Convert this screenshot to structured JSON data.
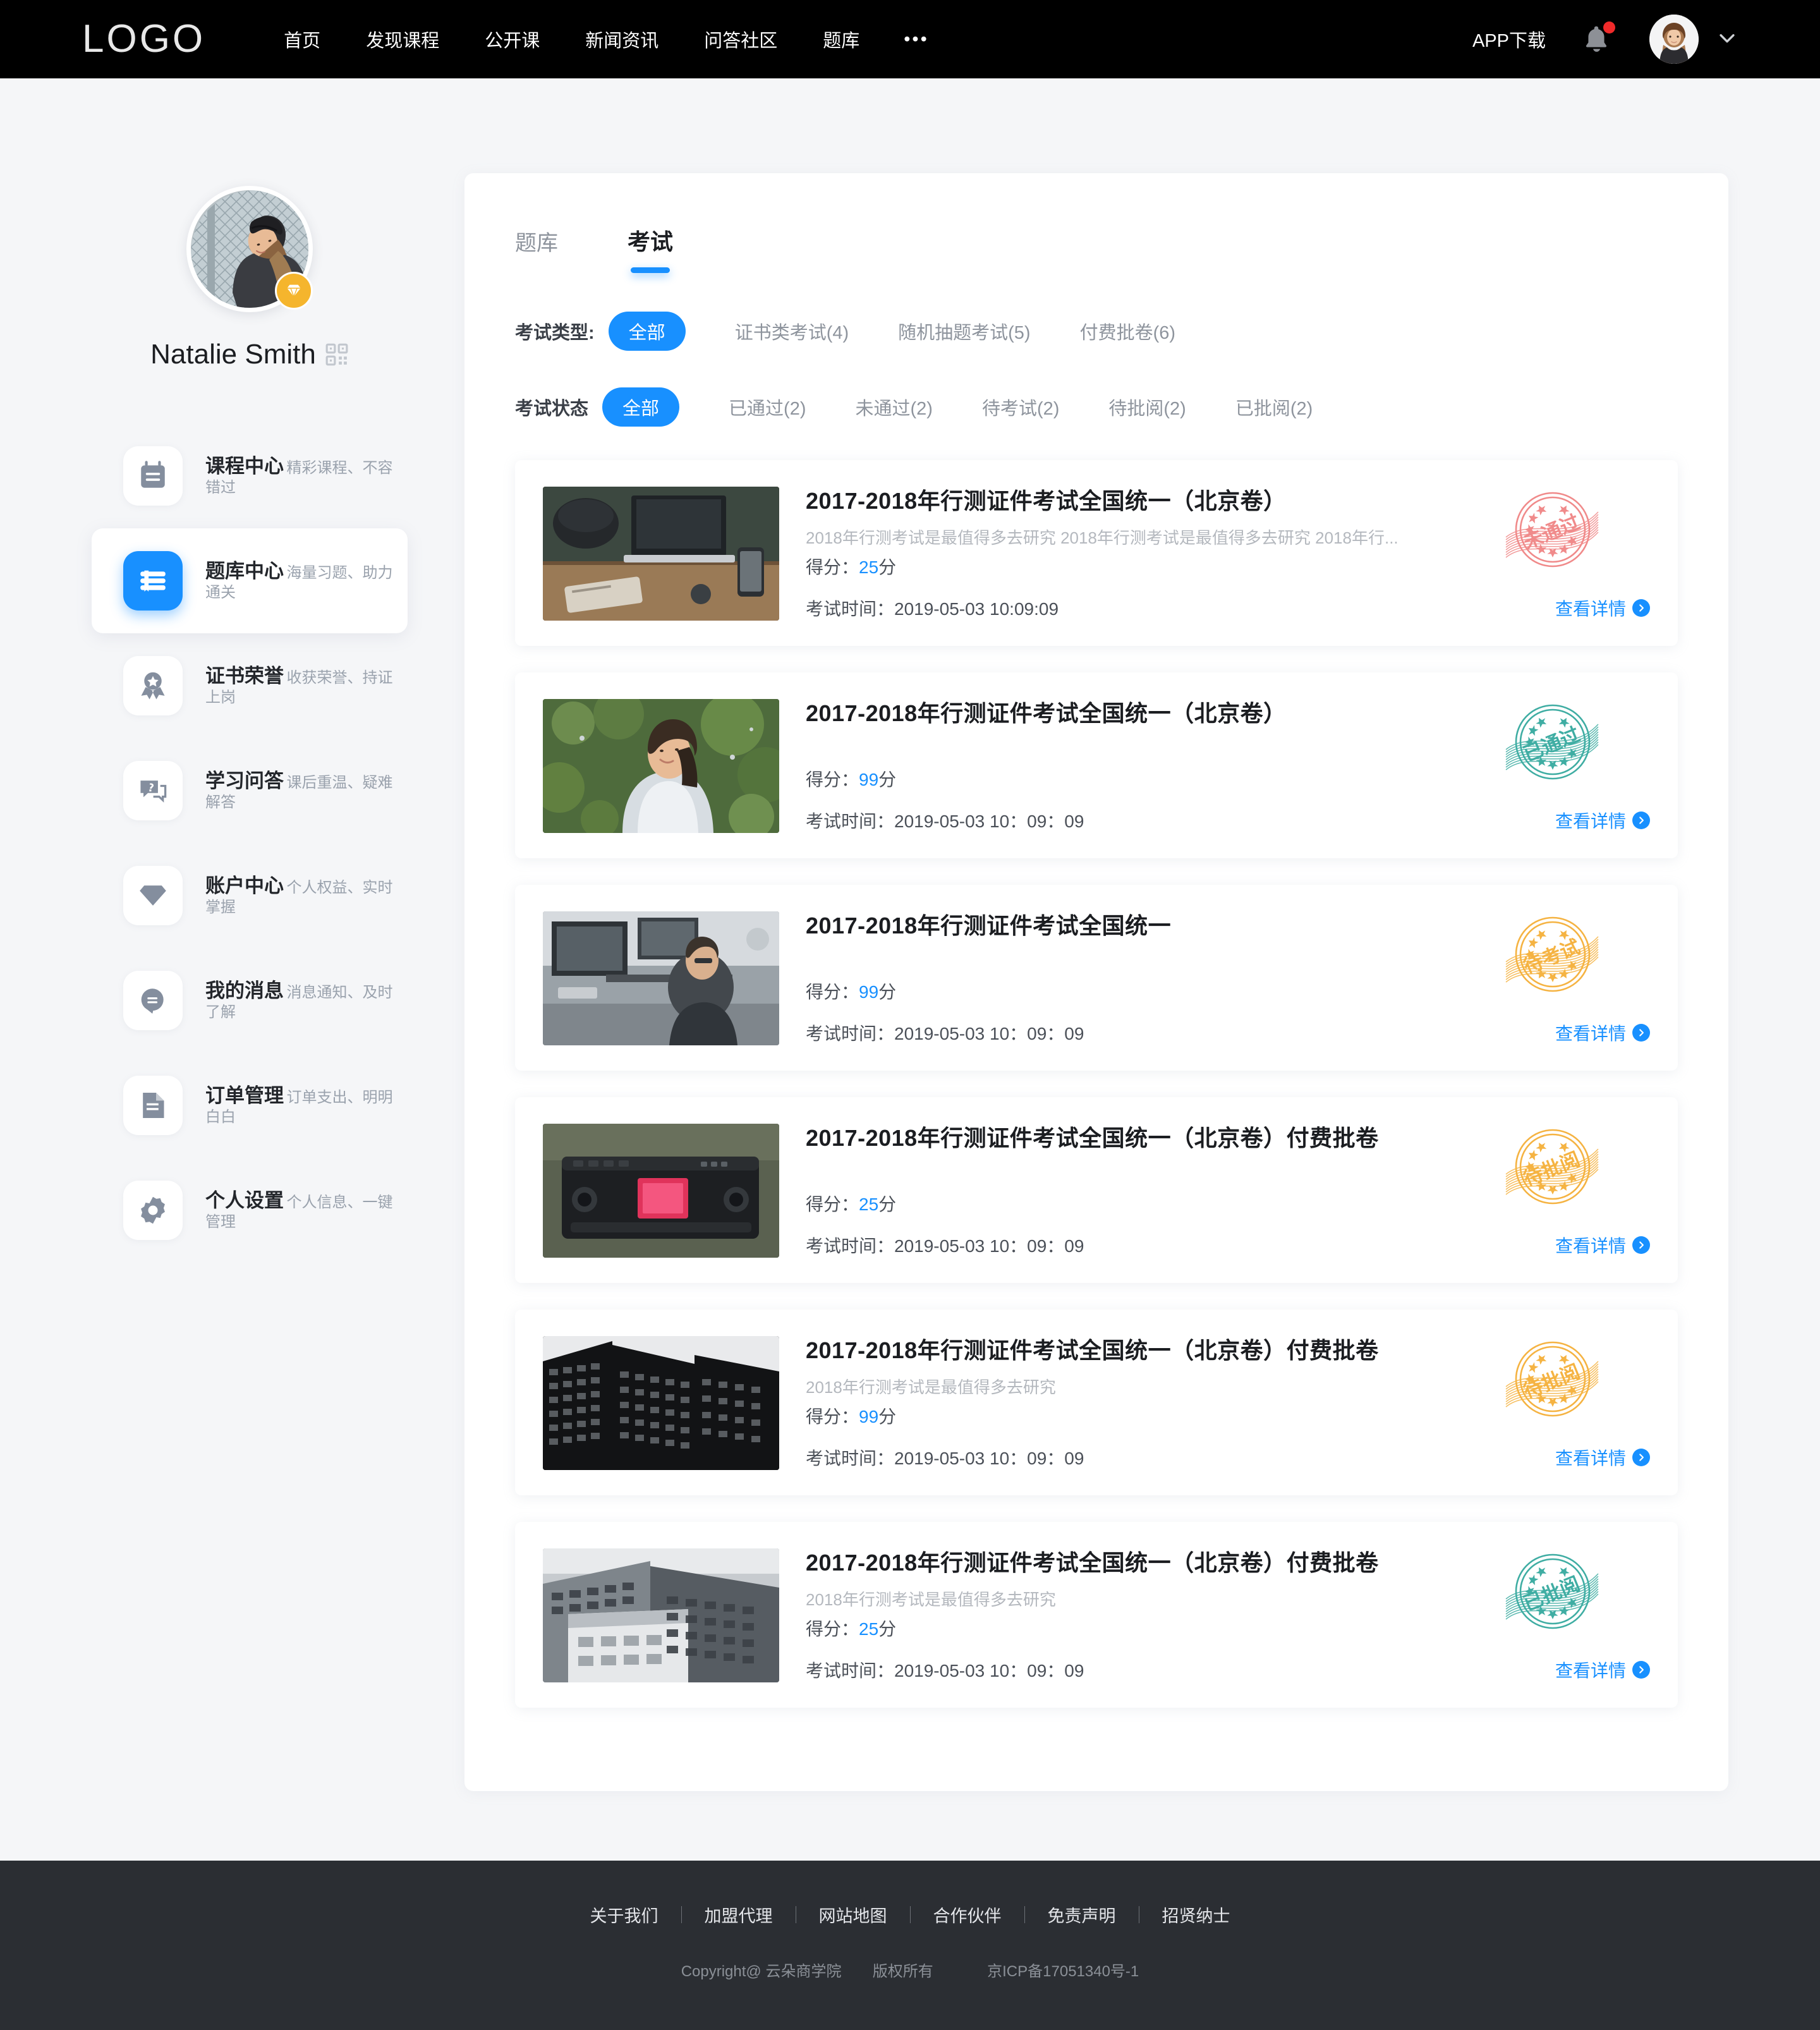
{
  "topnav": {
    "logo": "LOGO",
    "links": [
      "首页",
      "发现课程",
      "公开课",
      "新闻资讯",
      "问答社区",
      "题库"
    ],
    "more": "•••",
    "app_download": "APP下载",
    "bell_icon": "bell-icon",
    "avatar_icon": "user-avatar",
    "chevron_icon": "chevron-down-icon"
  },
  "sidebar": {
    "username": "Natalie Smith",
    "qr_icon": "qr-code-icon",
    "vip_icon": "diamond-badge-icon",
    "items": [
      {
        "title": "课程中心",
        "sub": "精彩课程、不容错过",
        "icon": "calendar-icon",
        "active": false
      },
      {
        "title": "题库中心",
        "sub": "海量习题、助力通关",
        "icon": "book-icon",
        "active": true
      },
      {
        "title": "证书荣誉",
        "sub": "收获荣誉、持证上岗",
        "icon": "medal-icon",
        "active": false
      },
      {
        "title": "学习问答",
        "sub": "课后重温、疑难解答",
        "icon": "question-bubble-icon",
        "active": false
      },
      {
        "title": "账户中心",
        "sub": "个人权益、实时掌握",
        "icon": "diamond-icon",
        "active": false
      },
      {
        "title": "我的消息",
        "sub": "消息通知、及时了解",
        "icon": "chat-bubble-icon",
        "active": false
      },
      {
        "title": "订单管理",
        "sub": "订单支出、明明白白",
        "icon": "document-icon",
        "active": false
      },
      {
        "title": "个人设置",
        "sub": "个人信息、一键管理",
        "icon": "gear-icon",
        "active": false
      }
    ]
  },
  "main": {
    "tabs": [
      {
        "label": "题库",
        "active": false
      },
      {
        "label": "考试",
        "active": true
      }
    ],
    "filters": [
      {
        "label": "考试类型:",
        "options": [
          {
            "label": "全部",
            "active": true
          },
          {
            "label": "证书类考试(4)",
            "active": false
          },
          {
            "label": "随机抽题考试(5)",
            "active": false
          },
          {
            "label": "付费批卷(6)",
            "active": false
          }
        ]
      },
      {
        "label": "考试状态",
        "options": [
          {
            "label": "全部",
            "active": true
          },
          {
            "label": "已通过(2)",
            "active": false
          },
          {
            "label": "未通过(2)",
            "active": false
          },
          {
            "label": "待考试(2)",
            "active": false
          },
          {
            "label": "待批阅(2)",
            "active": false
          },
          {
            "label": "已批阅(2)",
            "active": false
          }
        ]
      }
    ],
    "score_label": "得分：",
    "score_unit": "分",
    "time_label": "考试时间：",
    "detail_label": "查看详情",
    "cards": [
      {
        "title": "2017-2018年行测证件考试全国统一（北京卷）",
        "desc": "2018年行测考试是最值得多去研究 2018年行测考试是最值得多去研究 2018年行...",
        "score": "25",
        "time": "2019-05-03  10:09:09",
        "stamp_label": "未通过",
        "stamp_color": "#f08a8a",
        "thumb": "desk-laptop-photo"
      },
      {
        "title": "2017-2018年行测证件考试全国统一（北京卷）",
        "desc": "",
        "score": "99",
        "time": "2019-05-03  10：09：09",
        "stamp_label": "已通过",
        "stamp_color": "#3fada3",
        "thumb": "woman-garden-photo"
      },
      {
        "title": "2017-2018年行测证件考试全国统一",
        "desc": "",
        "score": "99",
        "time": "2019-05-03  10：09：09",
        "stamp_label": "待考试",
        "stamp_color": "#f5b342",
        "thumb": "office-desk-photo"
      },
      {
        "title": "2017-2018年行测证件考试全国统一（北京卷）付费批卷",
        "desc": "",
        "score": "25",
        "time": "2019-05-03  10：09：09",
        "stamp_label": "待批阅",
        "stamp_color": "#f5b342",
        "thumb": "camera-photo"
      },
      {
        "title": "2017-2018年行测证件考试全国统一（北京卷）付费批卷",
        "desc": "2018年行测考试是最值得多去研究",
        "score": "99",
        "time": "2019-05-03  10：09：09",
        "stamp_label": "待批阅",
        "stamp_color": "#f5b342",
        "thumb": "building-bw-photo"
      },
      {
        "title": "2017-2018年行测证件考试全国统一（北京卷）付费批卷",
        "desc": "2018年行测考试是最值得多去研究",
        "score": "25",
        "time": "2019-05-03  10：09：09",
        "stamp_label": "已批阅",
        "stamp_color": "#3fada3",
        "thumb": "building-photo"
      }
    ]
  },
  "footer": {
    "links": [
      "关于我们",
      "加盟代理",
      "网站地图",
      "合作伙伴",
      "免责声明",
      "招贤纳士"
    ],
    "copyright": "Copyright@ 云朵商学院",
    "rights": "版权所有",
    "icp": "京ICP备17051340号-1"
  },
  "colors": {
    "accent": "#1890ff",
    "nav_bg": "#000000",
    "page_bg": "#f5f6f8",
    "footer_bg": "#2b2e33",
    "vip": "#f5b52d"
  }
}
